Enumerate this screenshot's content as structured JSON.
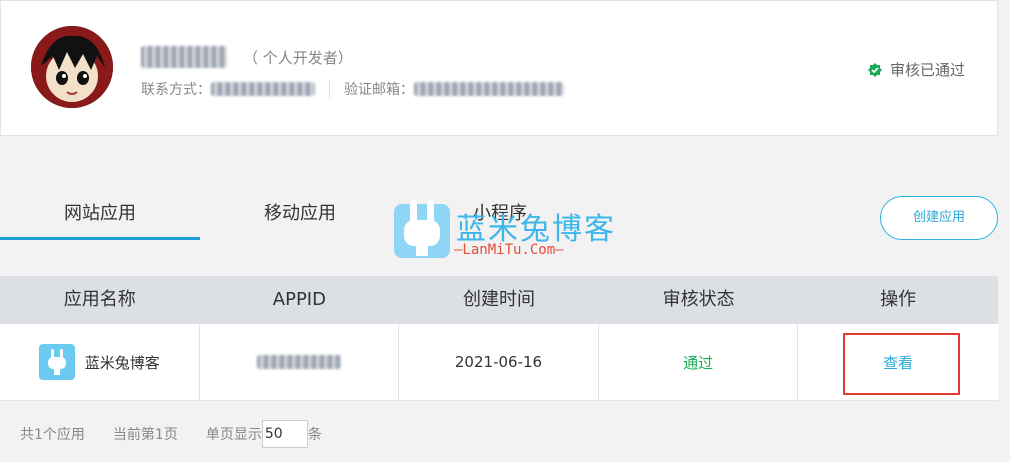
{
  "profile": {
    "name": "",
    "developer_type": "（ 个人开发者）",
    "contact_label": "联系方式：",
    "contact_value": "",
    "email_label": "验证邮箱：",
    "email_value": "",
    "status_text": "审核已通过",
    "status_icon": "check-circle-icon",
    "status_color": "#1aaa55"
  },
  "tabs": [
    {
      "label": "网站应用",
      "active": true
    },
    {
      "label": "移动应用",
      "active": false
    },
    {
      "label": "小程序",
      "active": false
    }
  ],
  "create_button": "创建应用",
  "watermark": {
    "title": "蓝米兔博客",
    "url": "—LanMiTu.Com—"
  },
  "table": {
    "headers": [
      "应用名称",
      "APPID",
      "创建时间",
      "审核状态",
      "操作"
    ],
    "rows": [
      {
        "name": "蓝米兔博客",
        "appid": "",
        "created": "2021-06-16",
        "status": "通过",
        "action": "查看"
      }
    ]
  },
  "footer": {
    "total": "共1个应用",
    "current_page": "当前第1页",
    "page_size_label": "单页显示",
    "page_size_value": "50",
    "page_size_unit": "条"
  },
  "colors": {
    "accent": "#1e9fd6",
    "pass": "#1aaa55",
    "highlight": "#e53935"
  }
}
